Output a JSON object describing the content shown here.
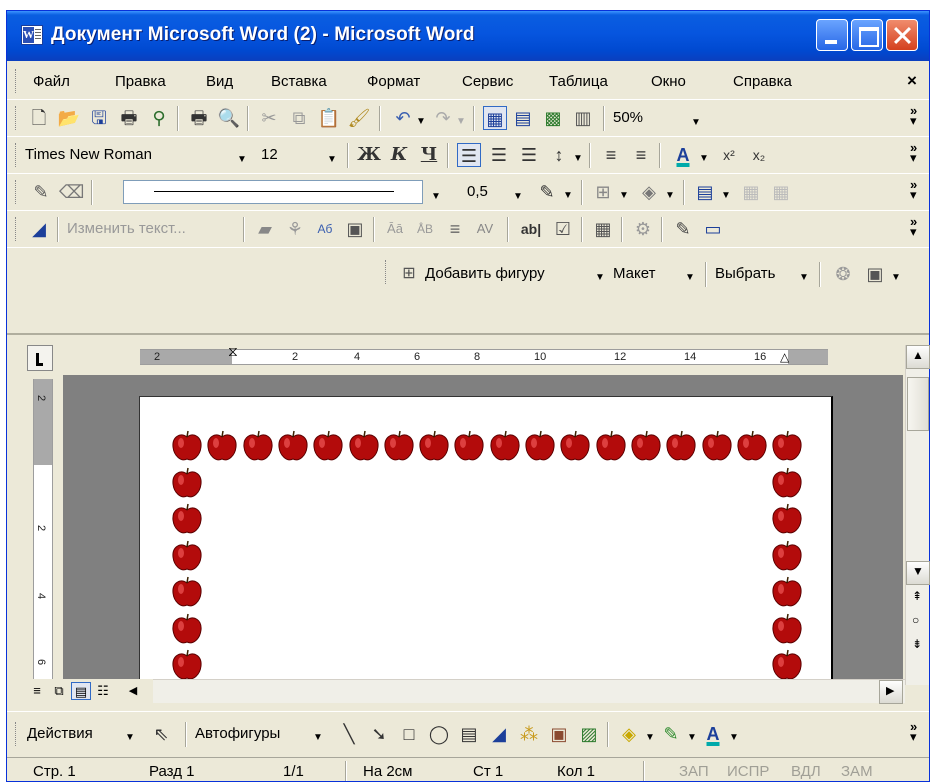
{
  "window": {
    "title": "Документ Microsoft Word (2) - Microsoft Word"
  },
  "menu": {
    "items": [
      "Файл",
      "Правка",
      "Вид",
      "Вставка",
      "Формат",
      "Сервис",
      "Таблица",
      "Окно",
      "Справка"
    ],
    "close_glyph": "×"
  },
  "standard_toolbar": {
    "zoom": "50%"
  },
  "formatting_toolbar": {
    "font": "Times New Roman",
    "size": "12",
    "bold": "Ж",
    "italic": "К",
    "underline": "Ч"
  },
  "drawing_line_toolbar": {
    "line_weight": "0,5"
  },
  "frames_toolbar": {
    "edit_text_label": "Изменить текст..."
  },
  "org_chart_toolbar": {
    "add_shape_label": "Добавить фигуру",
    "layout_label": "Макет",
    "select_label": "Выбрать"
  },
  "ruler": {
    "h_numbers": [
      "2",
      "2",
      "4",
      "6",
      "8",
      "10",
      "12",
      "14",
      "16"
    ],
    "v_numbers": [
      "2",
      "2",
      "4",
      "6"
    ]
  },
  "document": {
    "border_style": "red-apples",
    "apple_color": "#b30b0b"
  },
  "drawing_toolbar": {
    "actions_label": "Действия",
    "autoshapes_label": "Автофигуры"
  },
  "statusbar": {
    "page": "Стр. 1",
    "section": "Разд 1",
    "pages": "1/1",
    "at": "На 2см",
    "line": "Ст 1",
    "column": "Кол 1",
    "rec": "ЗАП",
    "trk": "ИСПР",
    "ext": "ВДЛ",
    "ovr": "ЗАМ"
  },
  "colors": {
    "titlebar": "#0655df",
    "chrome": "#ece9d8",
    "font_color": "#ff0000",
    "fill_color": "#ffff00",
    "line_color": "#00aa00"
  }
}
